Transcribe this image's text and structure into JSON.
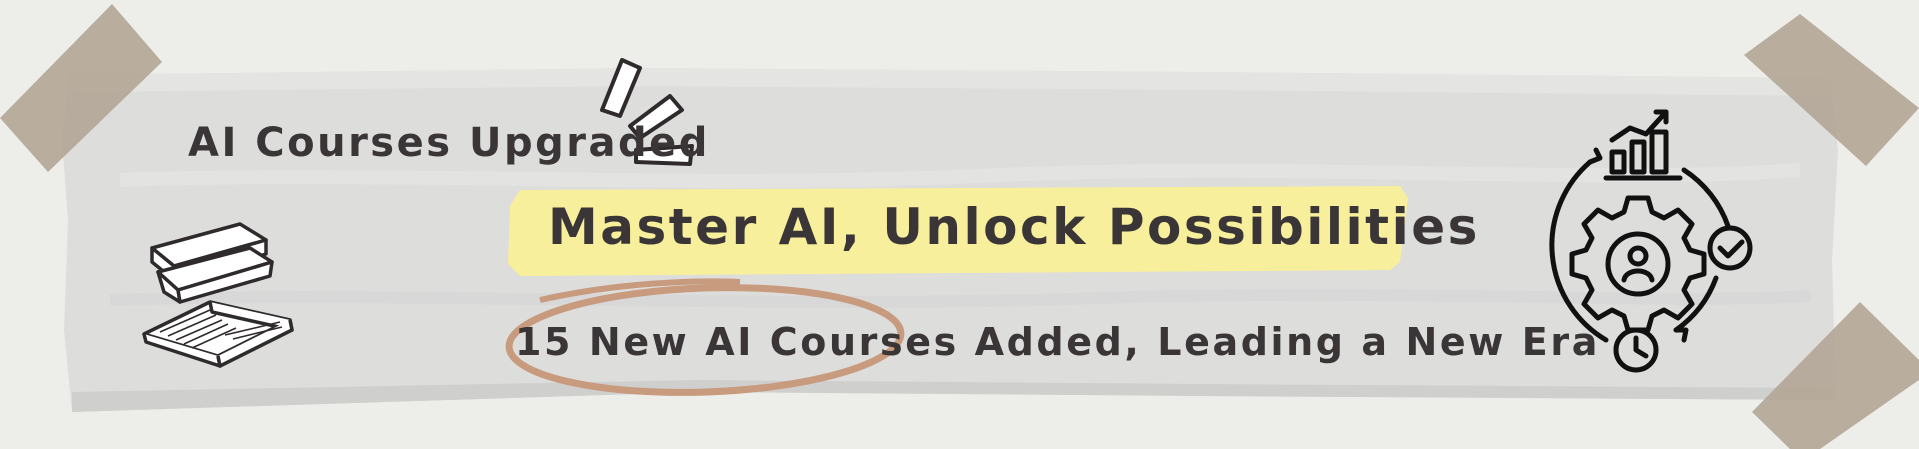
{
  "banner": {
    "headline_small": "AI Courses Upgraded",
    "headline_main": "Master AI, Unlock Possibilities",
    "subheadline": "15 New AI Courses Added, Leading a New Era"
  },
  "icons": {
    "left": "books-icon",
    "right": "gear-growth-cycle-icon",
    "accent": "spark-lines-icon"
  },
  "colors": {
    "background": "#ededea",
    "paper": "#dcdcdb",
    "tape": "#b3a596",
    "highlight": "#f7ef9b",
    "circle": "#c89b7e",
    "text": "#3a3536"
  }
}
